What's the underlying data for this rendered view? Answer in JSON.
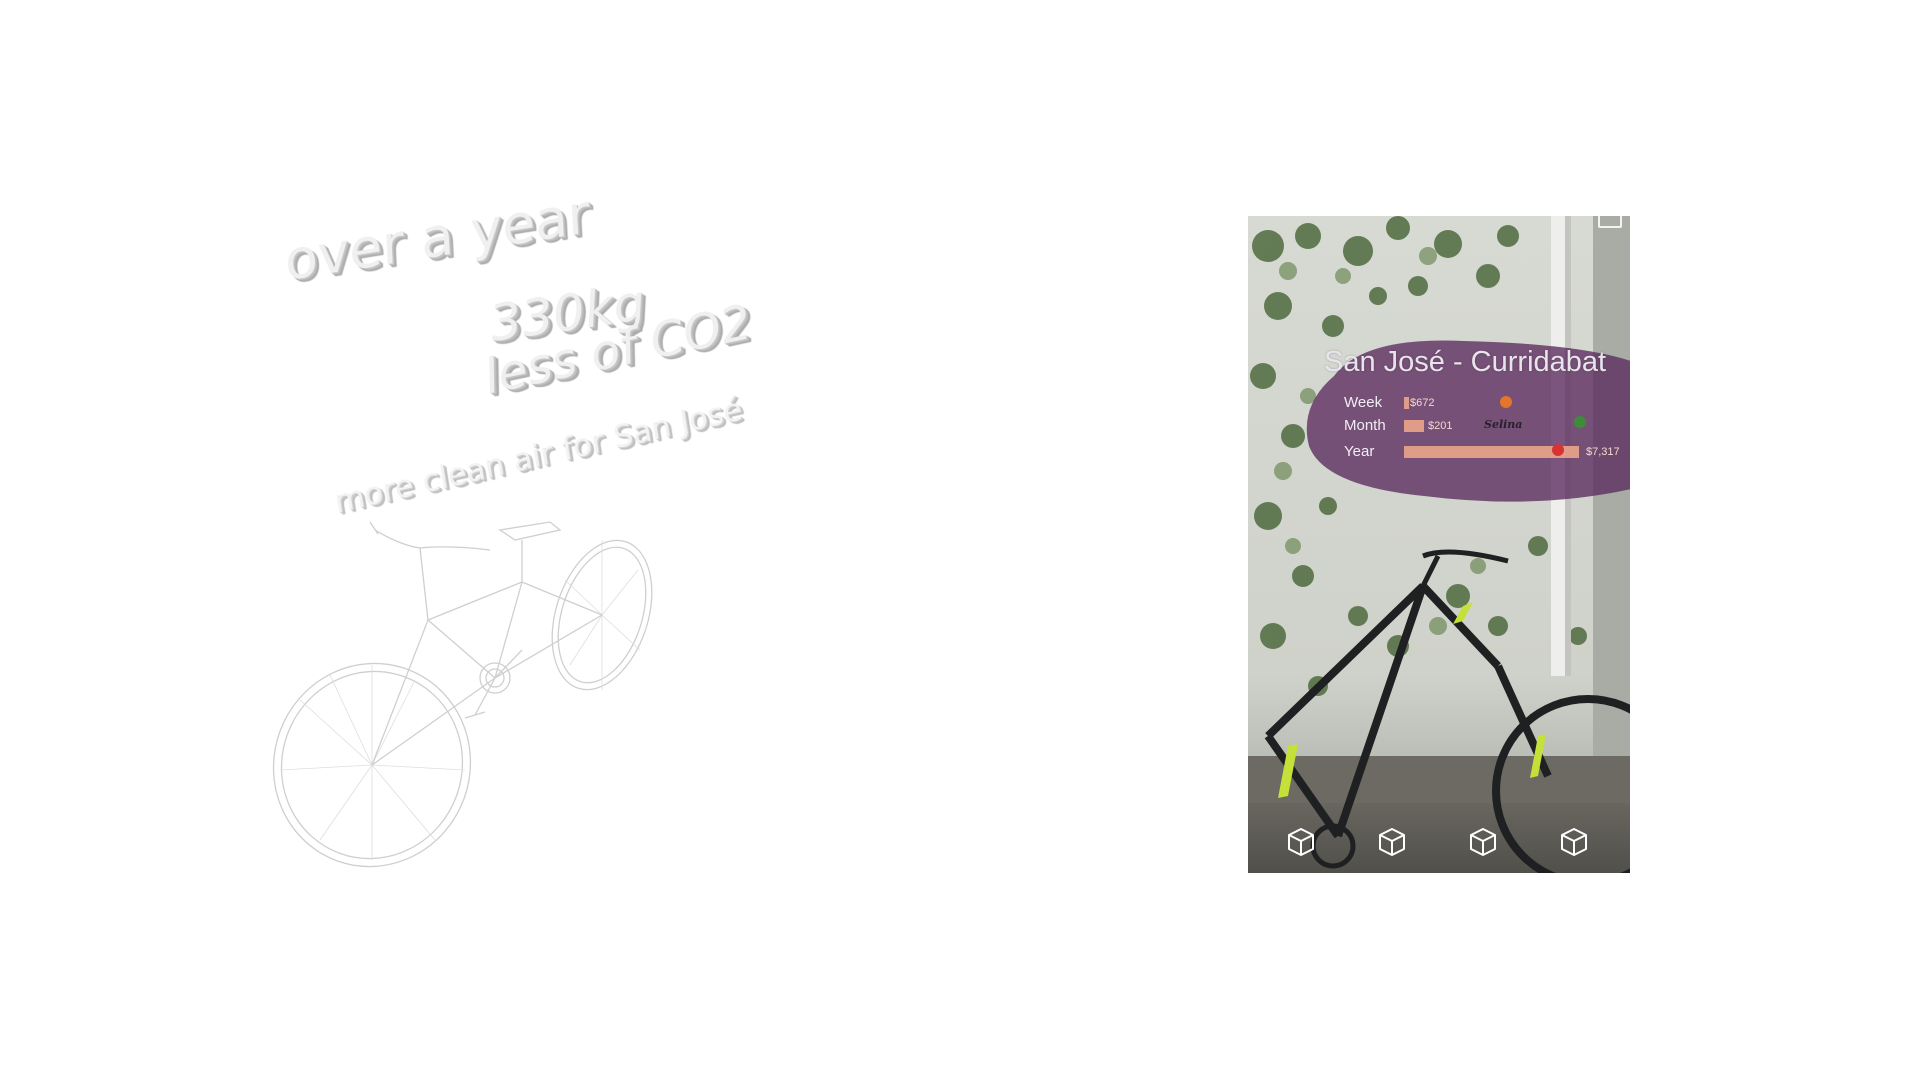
{
  "left_scene": {
    "line1": "over a year",
    "line2": "330kg",
    "line3": "less of CO2",
    "line4": "more clean air for San José",
    "bike_icon": "bicycle-wireframe-icon"
  },
  "ar_view": {
    "title": "San José - Curridabat",
    "rows": [
      {
        "label": "Week",
        "value": "$672",
        "fraction": 0.03
      },
      {
        "label": "Month",
        "value": "$201",
        "fraction": 0.11
      },
      {
        "label": "Year",
        "value": "$7,317",
        "fraction": 0.97
      }
    ],
    "brand": "Selina",
    "panel_color": "#5b2a5e",
    "bar_color": "#e8a48a",
    "toolbar": [
      {
        "icon": "cube-icon"
      },
      {
        "icon": "cube-icon"
      },
      {
        "icon": "cube-icon"
      },
      {
        "icon": "cube-icon"
      }
    ]
  }
}
